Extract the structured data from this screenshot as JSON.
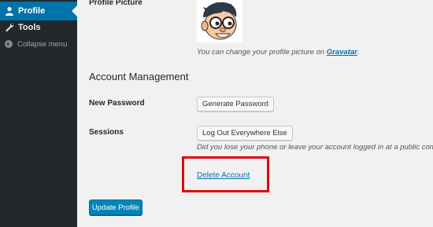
{
  "sidebar": {
    "items": [
      {
        "label": "Profile",
        "icon": "user-icon"
      },
      {
        "label": "Tools",
        "icon": "wrench-icon"
      },
      {
        "label": "Collapse menu",
        "icon": "collapse-icon"
      }
    ]
  },
  "profile_picture": {
    "label": "Profile Picture",
    "desc_prefix": "You can change your profile picture on ",
    "gravatar_link": "Gravatar",
    "desc_suffix": "."
  },
  "account_management": {
    "heading": "Account Management",
    "new_password_label": "New Password",
    "generate_password_button": "Generate Password",
    "sessions_label": "Sessions",
    "logout_button": "Log Out Everywhere Else",
    "sessions_desc": "Did you lose your phone or leave your account logged in at a public comp",
    "delete_account_link": "Delete Account"
  },
  "footer": {
    "update_profile_button": "Update Profile"
  },
  "colors": {
    "sidebar_bg": "#23282d",
    "active_item": "#0073aa",
    "link": "#0073aa",
    "highlight_box": "#e0070f",
    "primary_button": "#0085ba"
  }
}
